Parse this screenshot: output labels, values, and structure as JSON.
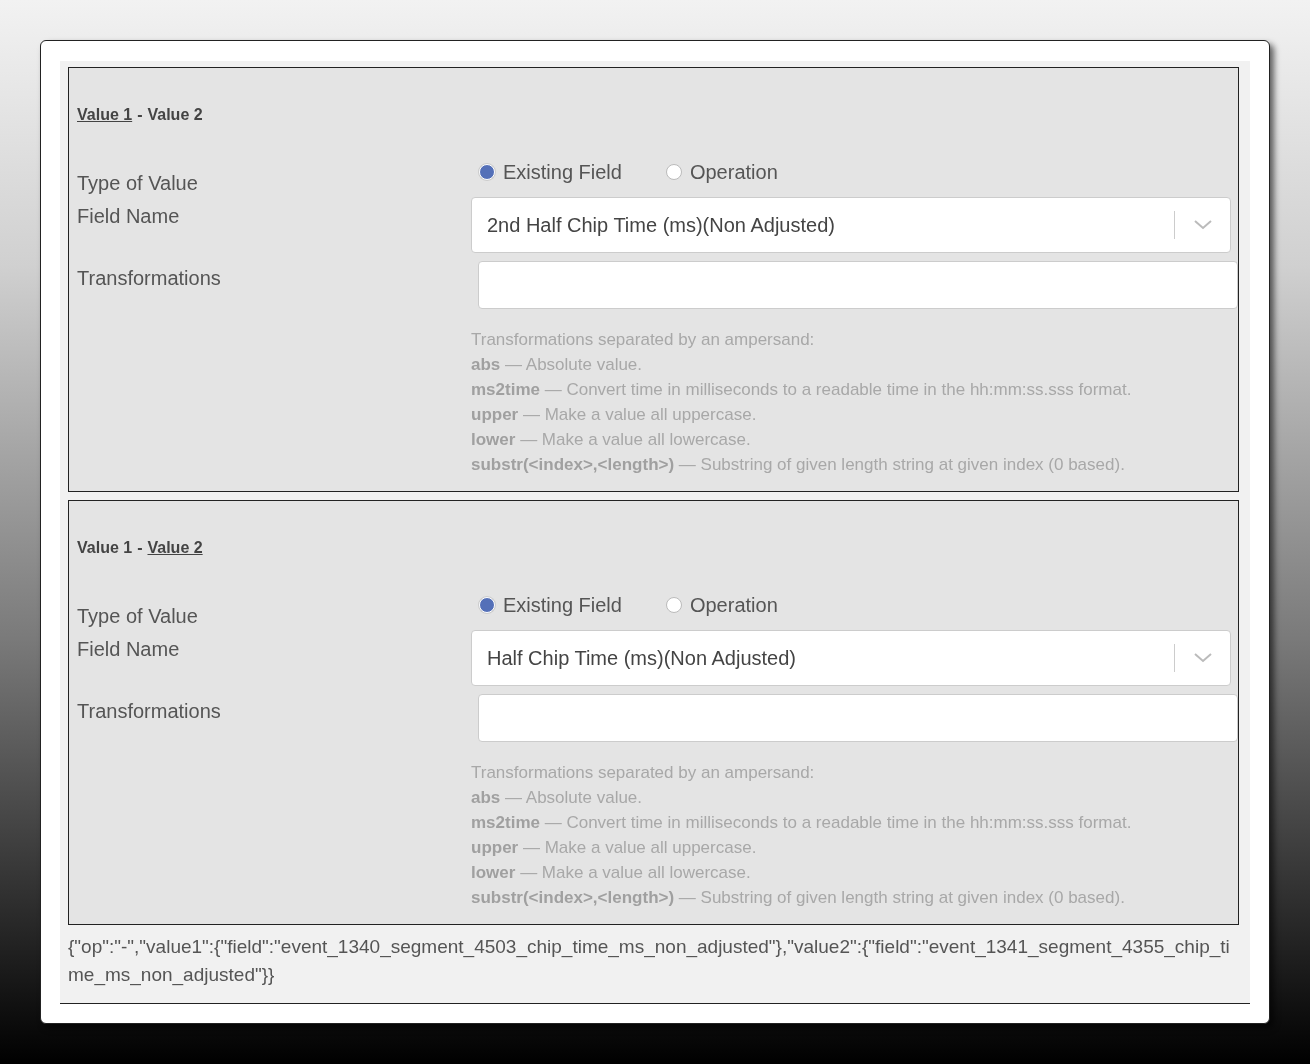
{
  "sections": [
    {
      "header": [
        {
          "label": "Value 1",
          "selected": true
        },
        {
          "label": "Value 2",
          "selected": false
        }
      ],
      "separator": "-",
      "type_label": "Type of Value",
      "radios": [
        {
          "label": "Existing Field",
          "selected": true
        },
        {
          "label": "Operation",
          "selected": false
        }
      ],
      "field_label": "Field Name",
      "field_value": "2nd Half Chip Time (ms)(Non Adjusted)",
      "transformations_label": "Transformations",
      "help_title": "Transformations separated by an ampersand:",
      "help_items": [
        "**abs** — Absolute value.",
        "**ms2time** — Convert time in milliseconds to a readable time in the hh:mm:ss.sss format.",
        "**upper** — Make a value all uppercase.",
        "**lower** — Make a value all lowercase.",
        "**substr(<index>,<length>)** — Substring of given length string at given index (0 based)."
      ]
    },
    {
      "header": [
        {
          "label": "Value 1",
          "selected": false
        },
        {
          "label": "Value 2",
          "selected": true
        }
      ],
      "separator": "-",
      "type_label": "Type of Value",
      "radios": [
        {
          "label": "Existing Field",
          "selected": true
        },
        {
          "label": "Operation",
          "selected": false
        }
      ],
      "field_label": "Field Name",
      "field_value": "Half Chip Time (ms)(Non Adjusted)",
      "transformations_label": "Transformations",
      "help_title": "Transformations separated by an ampersand:",
      "help_items": [
        "**abs** — Absolute value.",
        "**ms2time** — Convert time in milliseconds to a readable time in the hh:mm:ss.sss format.",
        "**upper** — Make a value all uppercase.",
        "**lower** — Make a value all lowercase.",
        "**substr(<index>,<length>)** — Substring of given length string at given index (0 based)."
      ]
    }
  ],
  "json_output": "{\"op\":\"-\",\"value1\":{\"field\":\"event_1340_segment_4503_chip_time_ms_non_adjusted\"},\"value2\":{\"field\":\"event_1341_segment_4355_chip_time_ms_non_adjusted\"}}"
}
